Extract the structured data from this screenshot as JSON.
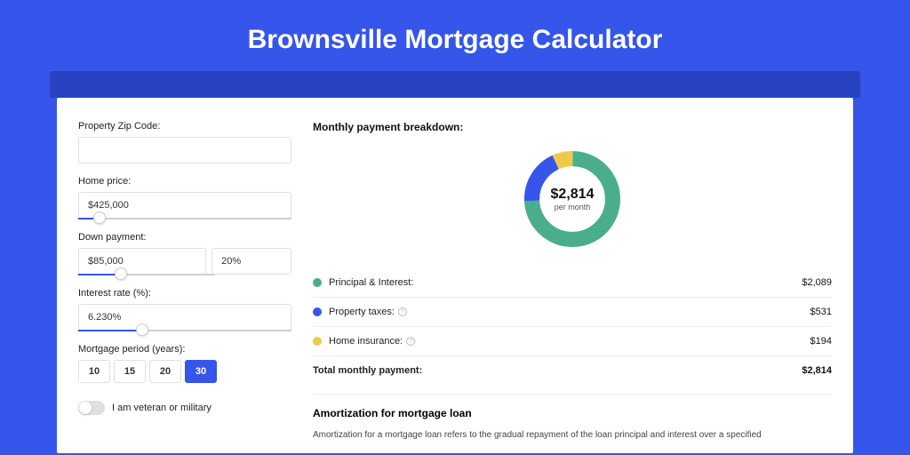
{
  "title": "Brownsville Mortgage Calculator",
  "form": {
    "zip_label": "Property Zip Code:",
    "zip_value": "",
    "home_price_label": "Home price:",
    "home_price_value": "$425,000",
    "home_price_slider_pct": 10,
    "down_payment_label": "Down payment:",
    "down_payment_value": "$85,000",
    "down_payment_pct": "20%",
    "down_payment_slider_pct": 20,
    "interest_label": "Interest rate (%):",
    "interest_value": "6.230%",
    "interest_slider_pct": 30,
    "period_label": "Mortgage period (years):",
    "periods": [
      "10",
      "15",
      "20",
      "30"
    ],
    "period_active_index": 3,
    "veteran_label": "I am veteran or military"
  },
  "breakdown": {
    "title": "Monthly payment breakdown:",
    "donut_amount": "$2,814",
    "donut_sub": "per month",
    "items": [
      {
        "label": "Principal & Interest:",
        "value": "$2,089",
        "color": "#4aae8c",
        "info": false
      },
      {
        "label": "Property taxes:",
        "value": "$531",
        "color": "#3555eb",
        "info": true
      },
      {
        "label": "Home insurance:",
        "value": "$194",
        "color": "#f0c94a",
        "info": true
      }
    ],
    "total_label": "Total monthly payment:",
    "total_value": "$2,814"
  },
  "amortization": {
    "title": "Amortization for mortgage loan",
    "text": "Amortization for a mortgage loan refers to the gradual repayment of the loan principal and interest over a specified"
  },
  "chart_data": {
    "type": "pie",
    "title": "Monthly payment breakdown",
    "series": [
      {
        "name": "Principal & Interest",
        "value": 2089,
        "color": "#4aae8c"
      },
      {
        "name": "Property taxes",
        "value": 531,
        "color": "#3555eb"
      },
      {
        "name": "Home insurance",
        "value": 194,
        "color": "#f0c94a"
      }
    ],
    "total": 2814,
    "center_label": "$2,814 per month"
  }
}
